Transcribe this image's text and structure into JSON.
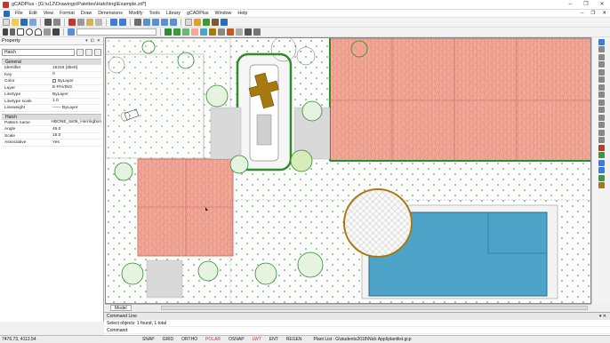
{
  "window": {
    "title": "gCADPlus - [G:\\u12\\Drawings\\Palettes\\Hatching\\Example.zd*]",
    "controls": [
      "–",
      "❐",
      "✕"
    ]
  },
  "menu": [
    "File",
    "Edit",
    "View",
    "Format",
    "Draw",
    "Dimensions",
    "Modify",
    "Tools",
    "Library",
    "gCADPlus",
    "Window",
    "Help"
  ],
  "toolbar": {
    "layer_combo": ""
  },
  "properties": {
    "panel_title": "Property",
    "selection": "Hatch",
    "general_header": "General",
    "general": [
      {
        "key": "Identifier",
        "value": "15316 [3be8]"
      },
      {
        "key": "Key",
        "value": "0"
      },
      {
        "key": "Color",
        "value": "ByLayer"
      },
      {
        "key": "Layer",
        "value": "E-PAVING"
      },
      {
        "key": "Linetype",
        "value": "ByLayer"
      },
      {
        "key": "Linetype scale",
        "value": "1.0"
      },
      {
        "key": "Lineweight",
        "value": "—— ByLayer"
      }
    ],
    "hatch_header": "Hatch",
    "hatch": [
      {
        "key": "Pattern name",
        "value": "HBONE_6x06_Herringbon"
      },
      {
        "key": "Angle",
        "value": "45.0"
      },
      {
        "key": "Scale",
        "value": "15.0"
      },
      {
        "key": "Associative",
        "value": "Yes"
      }
    ]
  },
  "tabs": {
    "model": "Model"
  },
  "command": {
    "title": "Command Line",
    "lines": [
      "Select objects: 1 found, 1 total",
      "Command:"
    ]
  },
  "status": {
    "coords": "7476.73, 4112.54",
    "toggles": [
      {
        "label": "SNAP",
        "on": false
      },
      {
        "label": "GRID",
        "on": false
      },
      {
        "label": "ORTHO",
        "on": false
      },
      {
        "label": "POLAR",
        "on": true
      },
      {
        "label": "OSNAP",
        "on": false
      },
      {
        "label": "LWT",
        "on": true
      },
      {
        "label": "ENT",
        "on": false
      },
      {
        "label": "REGEN",
        "on": false
      }
    ],
    "plant_list": "Plant List : G\\students2018\\Nick Appl\\plantlist.gcp"
  },
  "colors": {
    "paving": "#f2a898",
    "pool_water": "#4da3c8",
    "timber": "#a8790f",
    "plant_green": "#2e8b2e"
  }
}
